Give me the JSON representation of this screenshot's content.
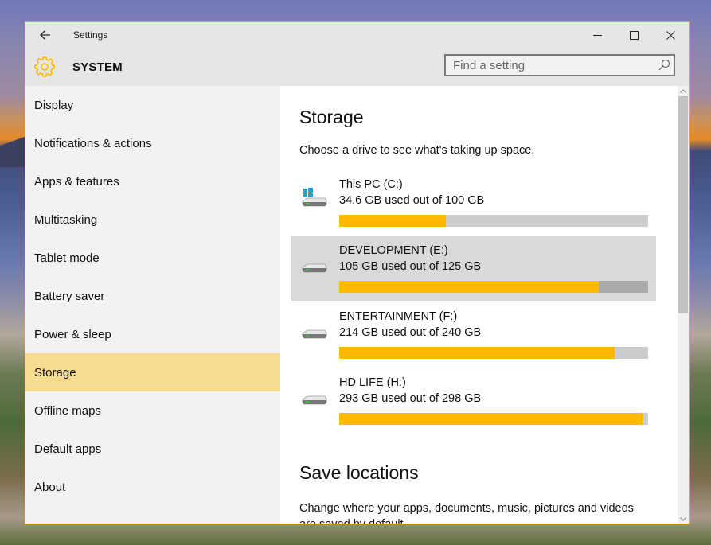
{
  "window": {
    "title": "Settings",
    "accent_color": "#ffb900",
    "controls": {
      "minimize": "minimize-icon",
      "maximize": "maximize-icon",
      "close": "close-icon"
    }
  },
  "header": {
    "section_title": "SYSTEM",
    "icon": "gear-icon",
    "search": {
      "placeholder": "Find a setting",
      "value": ""
    }
  },
  "sidebar": {
    "items": [
      {
        "label": "Display",
        "active": false
      },
      {
        "label": "Notifications & actions",
        "active": false
      },
      {
        "label": "Apps & features",
        "active": false
      },
      {
        "label": "Multitasking",
        "active": false
      },
      {
        "label": "Tablet mode",
        "active": false
      },
      {
        "label": "Battery saver",
        "active": false
      },
      {
        "label": "Power & sleep",
        "active": false
      },
      {
        "label": "Storage",
        "active": true
      },
      {
        "label": "Offline maps",
        "active": false
      },
      {
        "label": "Default apps",
        "active": false
      },
      {
        "label": "About",
        "active": false
      }
    ]
  },
  "main": {
    "title": "Storage",
    "description": "Choose a drive to see what's taking up space.",
    "drives": [
      {
        "name": "This PC (C:)",
        "usage": "34.6 GB used out of 100 GB",
        "used_gb": 34.6,
        "total_gb": 100,
        "system": true,
        "selected": false
      },
      {
        "name": "DEVELOPMENT (E:)",
        "usage": "105 GB used out of 125 GB",
        "used_gb": 105,
        "total_gb": 125,
        "system": false,
        "selected": true
      },
      {
        "name": "ENTERTAINMENT (F:)",
        "usage": "214 GB used out of 240 GB",
        "used_gb": 214,
        "total_gb": 240,
        "system": false,
        "selected": false
      },
      {
        "name": "HD LIFE (H:)",
        "usage": "293 GB used out of 298 GB",
        "used_gb": 293,
        "total_gb": 298,
        "system": false,
        "selected": false
      }
    ],
    "save_locations": {
      "title": "Save locations",
      "description": "Change where your apps, documents, music, pictures and videos are saved by default."
    }
  }
}
